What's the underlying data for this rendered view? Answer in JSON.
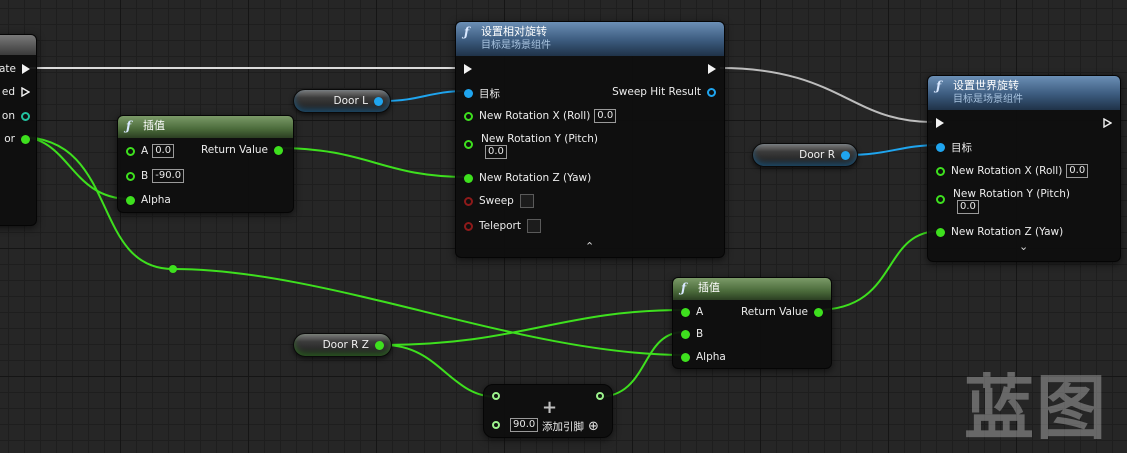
{
  "left_node": {
    "pins": [
      "ate",
      "ed",
      "on",
      "or"
    ]
  },
  "lerp1": {
    "title": "插值",
    "a_label": "A",
    "a_value": "0.0",
    "b_label": "B",
    "b_value": "-90.0",
    "alpha_label": "Alpha",
    "return_label": "Return Value"
  },
  "door_l": {
    "label": "Door L"
  },
  "door_r": {
    "label": "Door R"
  },
  "door_rz": {
    "label": "Door R Z"
  },
  "set_relative": {
    "title": "设置相对旋转",
    "subtitle": "目标是场景组件",
    "target_label": "目标",
    "sweep_hit_label": "Sweep Hit Result",
    "roll_label": "New Rotation X (Roll)",
    "roll_value": "0.0",
    "pitch_label": "New Rotation Y (Pitch)",
    "pitch_value": "0.0",
    "yaw_label": "New Rotation Z (Yaw)",
    "sweep_label": "Sweep",
    "teleport_label": "Teleport",
    "collapse": "⌃"
  },
  "set_world": {
    "title": "设置世界旋转",
    "subtitle": "目标是场景组件",
    "target_label": "目标",
    "roll_label": "New Rotation X (Roll)",
    "roll_value": "0.0",
    "pitch_label": "New Rotation Y (Pitch)",
    "pitch_value": "0.0",
    "yaw_label": "New Rotation Z (Yaw)",
    "expand": "⌄"
  },
  "lerp2": {
    "title": "插值",
    "a_label": "A",
    "b_label": "B",
    "alpha_label": "Alpha",
    "return_label": "Return Value"
  },
  "add_node": {
    "symbol": "+",
    "value": "90.0",
    "add_pin_label": "添加引脚",
    "add_pin_icon": "⊕"
  },
  "watermark": {
    "text": "蓝图"
  },
  "colors": {
    "exec": "#f2f2f2",
    "float": "#3ee01e",
    "object": "#1fa5ef",
    "bool": "#8e1a1a",
    "wire_exec": "#e0e0e0"
  }
}
